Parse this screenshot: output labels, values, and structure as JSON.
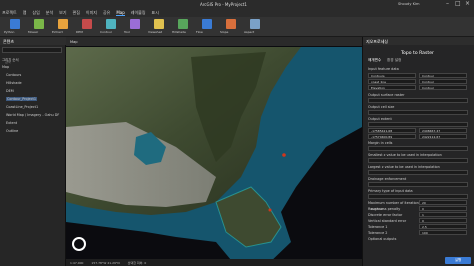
{
  "window": {
    "title": "ArcGIS Pro - MyProject1",
    "account": "Shoudy Kim"
  },
  "ribbon_tabs": [
    "프로젝트",
    "맵",
    "삽입",
    "분석",
    "보기",
    "편집",
    "이미지",
    "공유",
    "Map",
    "레이블링",
    "표시"
  ],
  "ribbon_buttons": [
    "Python",
    "Mosaic",
    "Extract",
    "DEM",
    "Contour",
    "Tool",
    "Viewshed",
    "Hillshade",
    "Flow",
    "Slope",
    "Aspect"
  ],
  "contents": {
    "title": "콘텐츠",
    "search_placeholder": "검색",
    "items": [
      "그리기 순서",
      "Map",
      "Contours",
      "Hillshade",
      "DEM",
      "Contour_Project1",
      "CoastLine_Project1",
      "World Map / Imagery - Oahu DF",
      "Extent",
      "Outline"
    ]
  },
  "map": {
    "tab": "Map",
    "scale": "1:47,000",
    "coords": "157.78°W 21.29°N",
    "selected_features": "선택한 피처: 0"
  },
  "geoprocessing": {
    "panel_title": "지오프로세싱",
    "tool_title": "Topo to Raster",
    "tabs": [
      "매개변수",
      "환경 설정"
    ],
    "input_label": "Input feature data",
    "inputs": [
      {
        "field": "Contours",
        "type": "Contour"
      },
      {
        "field": "coast_line",
        "type": "Contour"
      },
      {
        "field": "Elevation",
        "type": "Contour"
      }
    ],
    "output_surface_label": "Output surface raster",
    "output_surface_value": "Oahu_TopoToRaster",
    "cell_size_label": "Output cell size",
    "cell_size_value": "10",
    "extent_label": "Output extent",
    "extent_value": "현재 디스플레이 범위",
    "extent_values": [
      "-17585421.68",
      "2408467.47",
      "-17570400.89",
      "2422112.67"
    ],
    "margin_label": "Margin in cells",
    "margin_value": "20",
    "z_smaller_label": "Smallest z value to be used in interpolation",
    "z_larger_label": "Largest z value to be used in interpolation",
    "drainage_label": "Drainage enforcement",
    "drainage_value": "Enforce",
    "primary_label": "Primary type of input data",
    "primary_value": "Contour",
    "iterations_label": "Maximum number of iterations",
    "iterations_value": "20",
    "roughness_label": "Roughness penalty",
    "roughness_value": "0",
    "discretization_label": "Discrete error factor",
    "discretization_value": "1",
    "vertical_std_label": "Vertical standard error",
    "vertical_std_value": "0",
    "tolerance1_label": "Tolerance 1",
    "tolerance1_value": "2.5",
    "tolerance2_label": "Tolerance 2",
    "tolerance2_value": "100",
    "optional_outputs": "Optional outputs",
    "run_button": "실행"
  }
}
